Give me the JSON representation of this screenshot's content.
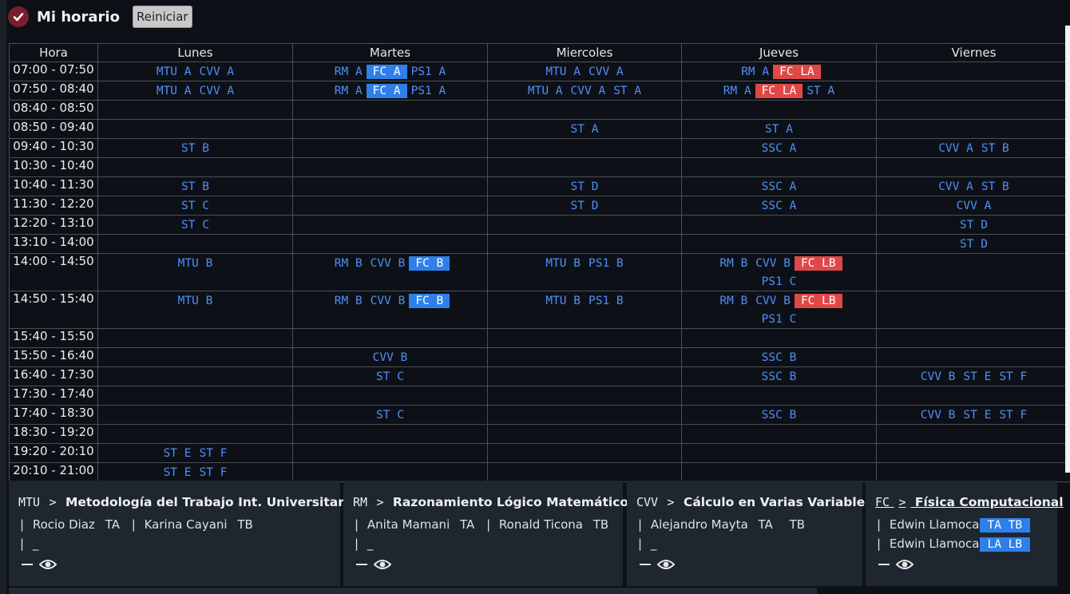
{
  "header": {
    "title": "Mi horario",
    "reset_label": "Reiniciar",
    "check_icon": "check-icon"
  },
  "table": {
    "headers": [
      "Hora",
      "Lunes",
      "Martes",
      "Miercoles",
      "Jueves",
      "Viernes"
    ],
    "rows": [
      {
        "hora": "07:00 - 07:50",
        "days": [
          [
            {
              "t": "MTU A"
            },
            {
              "t": "CVV A"
            }
          ],
          [
            {
              "t": "RM A"
            },
            {
              "t": "FC A",
              "s": "sel"
            },
            {
              "t": "PS1 A"
            }
          ],
          [
            {
              "t": "MTU A"
            },
            {
              "t": "CVV A"
            }
          ],
          [
            {
              "t": "RM A"
            },
            {
              "t": "FC LA",
              "s": "red"
            }
          ],
          []
        ]
      },
      {
        "hora": "07:50 - 08:40",
        "days": [
          [
            {
              "t": "MTU A"
            },
            {
              "t": "CVV A"
            }
          ],
          [
            {
              "t": "RM A"
            },
            {
              "t": "FC A",
              "s": "sel"
            },
            {
              "t": "PS1 A"
            }
          ],
          [
            {
              "t": "MTU A"
            },
            {
              "t": "CVV A"
            },
            {
              "t": "ST A"
            }
          ],
          [
            {
              "t": "RM A"
            },
            {
              "t": "FC LA",
              "s": "red"
            },
            {
              "t": "ST A"
            }
          ],
          []
        ]
      },
      {
        "hora": "08:40 - 08:50",
        "days": [
          [],
          [],
          [],
          [],
          []
        ]
      },
      {
        "hora": "08:50 - 09:40",
        "days": [
          [],
          [],
          [
            {
              "t": "ST A"
            }
          ],
          [
            {
              "t": "ST A"
            }
          ],
          []
        ]
      },
      {
        "hora": "09:40 - 10:30",
        "days": [
          [
            {
              "t": "ST B"
            }
          ],
          [],
          [],
          [
            {
              "t": "SSC A"
            }
          ],
          [
            {
              "t": "CVV A"
            },
            {
              "t": "ST B"
            }
          ]
        ]
      },
      {
        "hora": "10:30 - 10:40",
        "days": [
          [],
          [],
          [],
          [],
          []
        ]
      },
      {
        "hora": "10:40 - 11:30",
        "days": [
          [
            {
              "t": "ST B"
            }
          ],
          [],
          [
            {
              "t": "ST D"
            }
          ],
          [
            {
              "t": "SSC A"
            }
          ],
          [
            {
              "t": "CVV A"
            },
            {
              "t": "ST B"
            }
          ]
        ]
      },
      {
        "hora": "11:30 - 12:20",
        "days": [
          [
            {
              "t": "ST C"
            }
          ],
          [],
          [
            {
              "t": "ST D"
            }
          ],
          [
            {
              "t": "SSC A"
            }
          ],
          [
            {
              "t": "CVV A"
            }
          ]
        ]
      },
      {
        "hora": "12:20 - 13:10",
        "days": [
          [
            {
              "t": "ST C"
            }
          ],
          [],
          [],
          [],
          [
            {
              "t": "ST D"
            }
          ]
        ]
      },
      {
        "hora": "13:10 - 14:00",
        "days": [
          [],
          [],
          [],
          [],
          [
            {
              "t": "ST D"
            }
          ]
        ]
      },
      {
        "hora": "14:00 - 14:50",
        "tall": true,
        "days": [
          [
            {
              "t": "MTU B"
            }
          ],
          [
            {
              "t": "RM B"
            },
            {
              "t": "CVV B"
            },
            {
              "t": "FC B",
              "s": "sel"
            }
          ],
          [
            {
              "t": "MTU B"
            },
            {
              "t": "PS1 B"
            }
          ],
          [
            {
              "t": "RM B"
            },
            {
              "t": "CVV B"
            },
            {
              "t": "FC LB",
              "s": "red"
            },
            {
              "t": "PS1 C"
            }
          ],
          []
        ]
      },
      {
        "hora": "14:50 - 15:40",
        "tall": true,
        "days": [
          [
            {
              "t": "MTU B"
            }
          ],
          [
            {
              "t": "RM B"
            },
            {
              "t": "CVV B"
            },
            {
              "t": "FC B",
              "s": "sel"
            }
          ],
          [
            {
              "t": "MTU B"
            },
            {
              "t": "PS1 B"
            }
          ],
          [
            {
              "t": "RM B"
            },
            {
              "t": "CVV B"
            },
            {
              "t": "FC LB",
              "s": "red"
            },
            {
              "t": "PS1 C"
            }
          ],
          []
        ]
      },
      {
        "hora": "15:40 - 15:50",
        "days": [
          [],
          [],
          [],
          [],
          []
        ]
      },
      {
        "hora": "15:50 - 16:40",
        "days": [
          [],
          [
            {
              "t": "CVV B"
            }
          ],
          [],
          [
            {
              "t": "SSC B"
            }
          ],
          []
        ]
      },
      {
        "hora": "16:40 - 17:30",
        "days": [
          [],
          [
            {
              "t": "ST C"
            }
          ],
          [],
          [
            {
              "t": "SSC B"
            }
          ],
          [
            {
              "t": "CVV B"
            },
            {
              "t": "ST E"
            },
            {
              "t": "ST F"
            }
          ]
        ]
      },
      {
        "hora": "17:30 - 17:40",
        "days": [
          [],
          [],
          [],
          [],
          []
        ]
      },
      {
        "hora": "17:40 - 18:30",
        "days": [
          [],
          [
            {
              "t": "ST C"
            }
          ],
          [],
          [
            {
              "t": "SSC B"
            }
          ],
          [
            {
              "t": "CVV B"
            },
            {
              "t": "ST E"
            },
            {
              "t": "ST F"
            }
          ]
        ]
      },
      {
        "hora": "18:30 - 19:20",
        "days": [
          [],
          [],
          [],
          [],
          []
        ]
      },
      {
        "hora": "19:20 - 20:10",
        "days": [
          [
            {
              "t": "ST E"
            },
            {
              "t": "ST F"
            }
          ],
          [],
          [],
          [],
          []
        ]
      },
      {
        "hora": "20:10 - 21:00",
        "days": [
          [
            {
              "t": "ST E"
            },
            {
              "t": "ST F"
            }
          ],
          [],
          [],
          [],
          []
        ]
      }
    ]
  },
  "courses": [
    {
      "code": "MTU",
      "arrow": ">",
      "name": "Metodología del Trabajo Int. Universitario",
      "line1": {
        "bar1": "|",
        "t1": "Rocio Diaz",
        "g1": "TA",
        "bar2": "|",
        "t2": "Karina Cayani",
        "g2": "TB"
      },
      "line2": {
        "bar": "|",
        "text": "_"
      }
    },
    {
      "code": "RM",
      "arrow": ">",
      "name": "Razonamiento Lógico Matemático",
      "line1": {
        "bar1": "|",
        "t1": "Anita Mamani",
        "g1": "TA",
        "bar2": "|",
        "t2": "Ronald Ticona",
        "g2": "TB"
      },
      "line2": {
        "bar": "|",
        "text": "_"
      }
    },
    {
      "code": "CVV",
      "arrow": ">",
      "name": "Cálculo en Varias Variables",
      "line1": {
        "bar1": "|",
        "t1": "Alejandro Mayta",
        "g1": "TA",
        "g2": "TB"
      },
      "line2": {
        "bar": "|",
        "text": "_"
      }
    },
    {
      "code": "FC",
      "arrow": ">",
      "name": "Física Computacional",
      "line1": {
        "bar1": "|",
        "t1": "Edwin Llamoca",
        "hl": "TA   TB"
      },
      "line2": {
        "bar": "|",
        "text": "Edwin Llamoca",
        "hl": "LA   LB"
      }
    }
  ],
  "icons": {
    "minimize": "minus-icon",
    "view": "eye-icon"
  },
  "colors": {
    "accent": "#4f8ef7",
    "selected": "#2f7fea",
    "lab": "#e04848",
    "bg": "#0d1117",
    "card": "#1e2630"
  }
}
